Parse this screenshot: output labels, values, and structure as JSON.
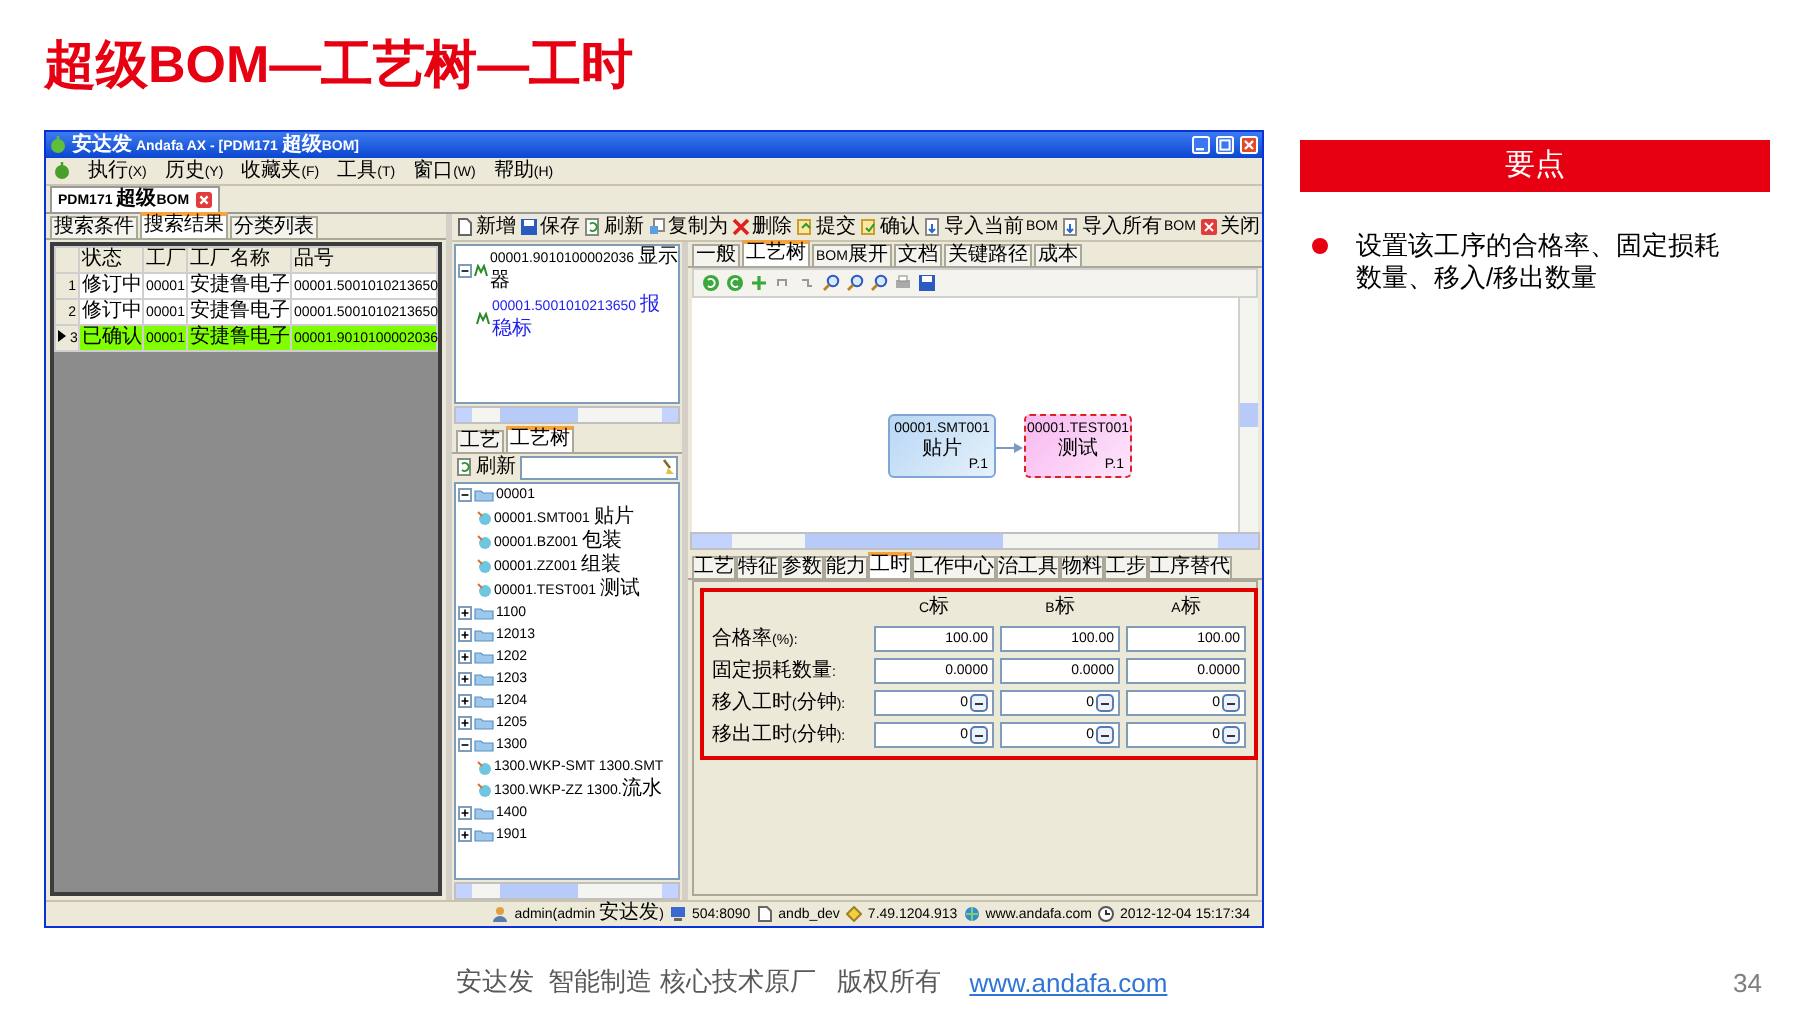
{
  "slide": {
    "title": "超级BOM—工艺树—工时",
    "page_number": "34"
  },
  "app": {
    "title": "安达发 Andafa AX - [PDM171 超级BOM]",
    "menu": [
      "执行(X)",
      "历史(Y)",
      "收藏夹(F)",
      "工具(T)",
      "窗口(W)",
      "帮助(H)"
    ],
    "document_tab": "PDM171 超级BOM",
    "left_tabs": [
      {
        "label": "搜索条件",
        "selected": false
      },
      {
        "label": "搜索结果",
        "selected": true
      },
      {
        "label": "分类列表",
        "selected": false
      }
    ],
    "grid": {
      "columns": [
        "状态",
        "工厂",
        "工厂名称",
        "品号"
      ],
      "rows": [
        {
          "number": "1",
          "cells": [
            "修订中",
            "00001",
            "安捷鲁电子",
            "00001.5001010213650"
          ],
          "selected": false
        },
        {
          "number": "2",
          "cells": [
            "修订中",
            "00001",
            "安捷鲁电子",
            "00001.5001010213650"
          ],
          "selected": false
        },
        {
          "number": "3",
          "cells": [
            "已确认",
            "00001",
            "安捷鲁电子",
            "00001.9010100002036"
          ],
          "selected": true
        }
      ]
    },
    "toolbar": [
      "新增",
      "保存",
      "刷新",
      "复制为",
      "删除",
      "提交",
      "确认",
      "导入当前BOM",
      "导入所有BOM",
      "关闭"
    ],
    "bom_tree": [
      {
        "label": "00001.9010100002036 显示器",
        "expanded": true,
        "selected": false,
        "children": [
          {
            "label": "00001.5001010213650 报稳标",
            "selected": true
          }
        ]
      }
    ],
    "middle_tabs": [
      {
        "label": "工艺",
        "selected": false
      },
      {
        "label": "工艺树",
        "selected": true
      }
    ],
    "tree_refresh": "刷新",
    "process_tree": [
      {
        "label": "00001",
        "expanded": true,
        "children": [
          {
            "label": "00001.SMT001 贴片"
          },
          {
            "label": "00001.BZ001 包装"
          },
          {
            "label": "00001.ZZ001 组装"
          },
          {
            "label": "00001.TEST001 测试"
          }
        ]
      },
      {
        "label": "1100",
        "expanded": false
      },
      {
        "label": "12013",
        "expanded": false
      },
      {
        "label": "1202",
        "expanded": false
      },
      {
        "label": "1203",
        "expanded": false
      },
      {
        "label": "1204",
        "expanded": false
      },
      {
        "label": "1205",
        "expanded": false
      },
      {
        "label": "1300",
        "expanded": true,
        "children": [
          {
            "label": "1300.WKP-SMT 1300.SMT"
          },
          {
            "label": "1300.WKP-ZZ 1300.流水"
          }
        ]
      },
      {
        "label": "1400",
        "expanded": false
      },
      {
        "label": "1901",
        "expanded": false
      }
    ],
    "view_tabs": [
      {
        "label": "一般",
        "selected": false
      },
      {
        "label": "工艺树",
        "selected": true
      },
      {
        "label": "BOM展开",
        "selected": false
      },
      {
        "label": "文档",
        "selected": false
      },
      {
        "label": "关键路径",
        "selected": false
      },
      {
        "label": "成本",
        "selected": false
      }
    ],
    "flow_nodes": [
      {
        "code": "00001.SMT001",
        "name": "贴片",
        "page": "P.1",
        "selected": false
      },
      {
        "code": "00001.TEST001",
        "name": "测试",
        "page": "P.1",
        "selected": true
      }
    ],
    "detail_tabs": [
      {
        "label": "工艺",
        "selected": false
      },
      {
        "label": "特征",
        "selected": false
      },
      {
        "label": "参数",
        "selected": false
      },
      {
        "label": "能力",
        "selected": false
      },
      {
        "label": "工时",
        "selected": true
      },
      {
        "label": "工作中心",
        "selected": false
      },
      {
        "label": "治工具",
        "selected": false
      },
      {
        "label": "物料",
        "selected": false
      },
      {
        "label": "工步",
        "selected": false
      },
      {
        "label": "工序替代",
        "selected": false
      }
    ],
    "hours_form": {
      "columns": [
        "C标",
        "B标",
        "A标"
      ],
      "rows": [
        {
          "label": "合格率(%):",
          "kind": "number",
          "values": [
            "100.00",
            "100.00",
            "100.00"
          ]
        },
        {
          "label": "固定损耗数量:",
          "kind": "number",
          "values": [
            "0.0000",
            "0.0000",
            "0.0000"
          ]
        },
        {
          "label": "移入工时(分钟):",
          "kind": "minutes",
          "values": [
            "0",
            "0",
            "0"
          ]
        },
        {
          "label": "移出工时(分钟):",
          "kind": "minutes",
          "values": [
            "0",
            "0",
            "0"
          ]
        }
      ]
    },
    "status_bar": [
      "admin(admin 安达发)",
      "504:8090",
      "andb_dev",
      "7.49.1204.913",
      "www.andafa.com",
      "2012-12-04 15:17:34"
    ]
  },
  "key_points": {
    "title": "要点",
    "bullets": [
      "设置该工序的合格率、固定损耗数量、移入/移出数量"
    ]
  },
  "footer": {
    "text": "安达发  智能制造 核心技术原厂   版权所有",
    "link": "www.andafa.com"
  }
}
